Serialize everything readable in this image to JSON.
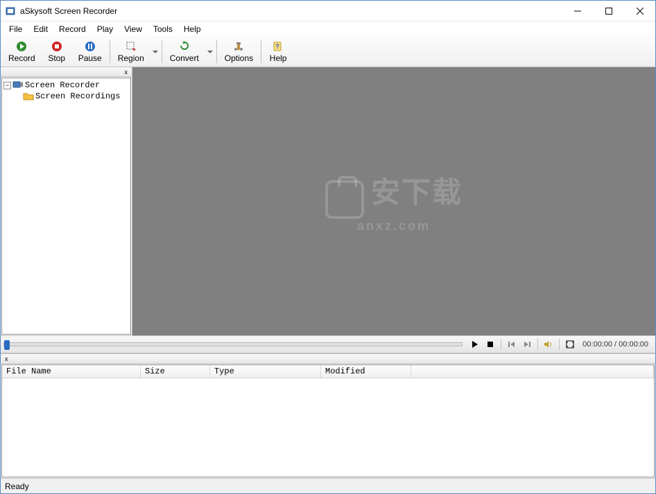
{
  "title": "aSkysoft Screen Recorder",
  "menu": [
    "File",
    "Edit",
    "Record",
    "Play",
    "View",
    "Tools",
    "Help"
  ],
  "toolbar": {
    "record": "Record",
    "stop": "Stop",
    "pause": "Pause",
    "region": "Region",
    "convert": "Convert",
    "options": "Options",
    "help": "Help"
  },
  "tree": {
    "root": "Screen Recorder",
    "child": "Screen Recordings"
  },
  "watermark": {
    "text": "安下载",
    "url": "anxz.com"
  },
  "playback": {
    "current": "00:00:00",
    "total": "00:00:00"
  },
  "list_columns": {
    "filename": "File Name",
    "size": "Size",
    "type": "Type",
    "modified": "Modified"
  },
  "status": "Ready",
  "sidebar_close": "x",
  "bottom_close": "x"
}
